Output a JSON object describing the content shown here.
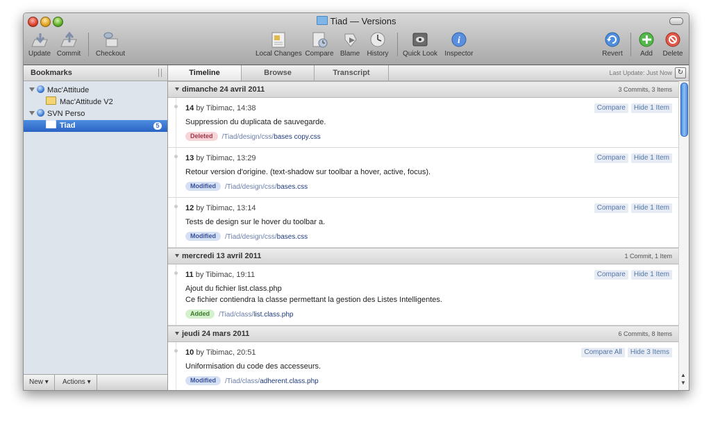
{
  "window": {
    "title": "Tiad — Versions"
  },
  "toolbar": {
    "update": "Update",
    "commit": "Commit",
    "checkout": "Checkout",
    "local_changes": "Local Changes",
    "compare": "Compare",
    "blame": "Blame",
    "history": "History",
    "quick_look": "Quick Look",
    "inspector": "Inspector",
    "revert": "Revert",
    "add": "Add",
    "delete": "Delete"
  },
  "sidebar": {
    "header": "Bookmarks",
    "items": [
      {
        "label": "Mac'Attitude"
      },
      {
        "label": "Mac'Attitude V2"
      },
      {
        "label": "SVN Perso"
      },
      {
        "label": "Tiad",
        "badge": "5"
      }
    ],
    "footer": {
      "new": "New ▾",
      "actions": "Actions ▾"
    }
  },
  "tabs": {
    "timeline": "Timeline",
    "browse": "Browse",
    "transcript": "Transcript",
    "last_update": "Last Update: Just Now"
  },
  "days": [
    {
      "title": "dimanche 24 avril 2011",
      "count": "3 Commits, 3 Items",
      "commits": [
        {
          "rev": "14",
          "meta": "by Tibimac, 14:38",
          "msg": "Suppression du duplicata de sauvegarde.",
          "tag": "Deleted",
          "path": "/Tiad/design/css/",
          "file": "bases copy.css",
          "compare": "Compare",
          "hide": "Hide 1 Item"
        },
        {
          "rev": "13",
          "meta": "by Tibimac, 13:29",
          "msg": "Retour version d'origine. (text-shadow sur toolbar a hover, active, focus).",
          "tag": "Modified",
          "path": "/Tiad/design/css/",
          "file": "bases.css",
          "compare": "Compare",
          "hide": "Hide 1 Item"
        },
        {
          "rev": "12",
          "meta": "by Tibimac, 13:14",
          "msg": "Tests de design sur le hover du toolbar a.",
          "tag": "Modified",
          "path": "/Tiad/design/css/",
          "file": "bases.css",
          "compare": "Compare",
          "hide": "Hide 1 Item"
        }
      ]
    },
    {
      "title": "mercredi 13 avril 2011",
      "count": "1 Commit, 1 Item",
      "commits": [
        {
          "rev": "11",
          "meta": "by Tibimac, 19:11",
          "msg": "Ajout du fichier list.class.php",
          "msg2": "Ce fichier contiendra la classe permettant la gestion des Listes Intelligentes.",
          "tag": "Added",
          "path": "/Tiad/class/",
          "file": "list.class.php",
          "compare": "Compare",
          "hide": "Hide 1 Item"
        }
      ]
    },
    {
      "title": "jeudi 24 mars 2011",
      "count": "6 Commits, 8 Items",
      "commits": [
        {
          "rev": "10",
          "meta": "by Tibimac, 20:51",
          "msg": "Uniformisation du code des accesseurs.",
          "tag": "Modified",
          "path": "/Tiad/class/",
          "file": "adherent.class.php",
          "compare": "Compare All",
          "hide": "Hide 3 Items"
        }
      ]
    }
  ]
}
